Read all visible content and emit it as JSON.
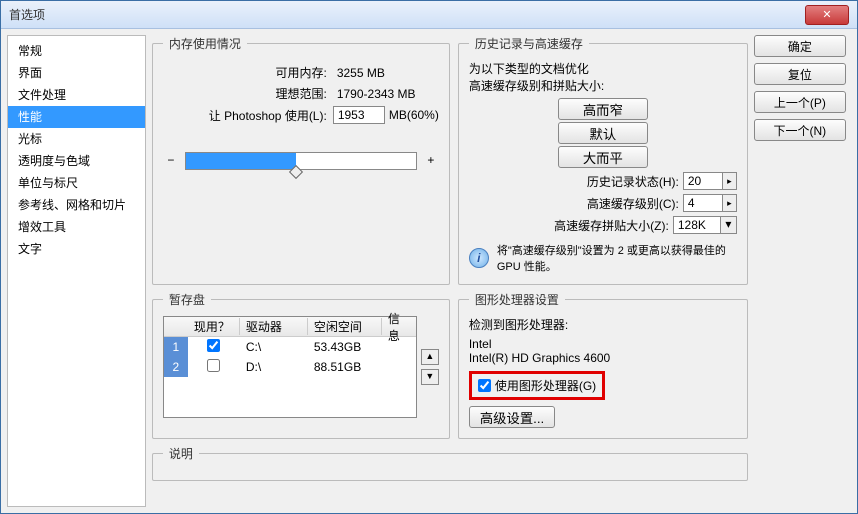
{
  "window": {
    "title": "首选项"
  },
  "sidebar": {
    "items": [
      "常规",
      "界面",
      "文件处理",
      "性能",
      "光标",
      "透明度与色域",
      "单位与标尺",
      "参考线、网格和切片",
      "增效工具",
      "文字"
    ],
    "selected": 3
  },
  "buttons": {
    "ok": "确定",
    "reset": "复位",
    "prev": "上一个(P)",
    "next": "下一个(N)"
  },
  "memory": {
    "legend": "内存使用情况",
    "avail_label": "可用内存:",
    "avail_value": "3255 MB",
    "ideal_label": "理想范围:",
    "ideal_value": "1790-2343 MB",
    "let_label": "让 Photoshop 使用(L):",
    "let_value": "1953",
    "let_suffix": "MB(60%)"
  },
  "history": {
    "legend": "历史记录与高速缓存",
    "optimize_hint": "为以下类型的文档优化\n高速缓存级别和拼贴大小:",
    "tall_btn": "高而窄",
    "default_btn": "默认",
    "big_btn": "大而平",
    "states_label": "历史记录状态(H):",
    "states_value": "20",
    "levels_label": "高速缓存级别(C):",
    "levels_value": "4",
    "tile_label": "高速缓存拼贴大小(Z):",
    "tile_value": "128K",
    "info_text": "将\"高速缓存级别\"设置为 2 或更高以获得最佳的 GPU 性能。"
  },
  "scratch": {
    "legend": "暂存盘",
    "col_active": "现用？",
    "col_drive": "驱动器",
    "col_free": "空闲空间",
    "col_info": "信息",
    "rows": [
      {
        "n": "1",
        "active": true,
        "drive": "C:\\",
        "free": "53.43GB"
      },
      {
        "n": "2",
        "active": false,
        "drive": "D:\\",
        "free": "88.51GB"
      }
    ]
  },
  "gpu": {
    "legend": "图形处理器设置",
    "detected_label": "检测到图形处理器:",
    "vendor": "Intel",
    "model": "Intel(R) HD Graphics 4600",
    "use_label": "使用图形处理器(G)",
    "adv_btn": "高级设置..."
  },
  "desc": {
    "legend": "说明"
  }
}
